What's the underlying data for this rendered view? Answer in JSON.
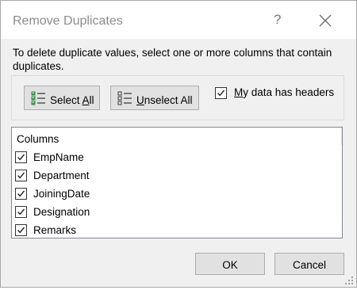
{
  "window": {
    "title": "Remove Duplicates",
    "help": "?",
    "close_icon": "close-icon"
  },
  "description": "To delete duplicate values, select one or more columns that contain duplicates.",
  "buttons": {
    "select_all_pre": "Select ",
    "select_all_ul": "A",
    "select_all_post": "ll",
    "unselect_all_ul": "U",
    "unselect_all_post": "nselect All",
    "ok": "OK",
    "cancel": "Cancel"
  },
  "headers_option": {
    "checked": true,
    "label_ul": "M",
    "label_post": "y data has headers"
  },
  "columns": {
    "header": "Columns",
    "items": [
      {
        "label": "EmpName",
        "checked": true
      },
      {
        "label": "Department",
        "checked": true
      },
      {
        "label": "JoiningDate",
        "checked": true
      },
      {
        "label": "Designation",
        "checked": true
      },
      {
        "label": "Remarks",
        "checked": true
      }
    ]
  }
}
